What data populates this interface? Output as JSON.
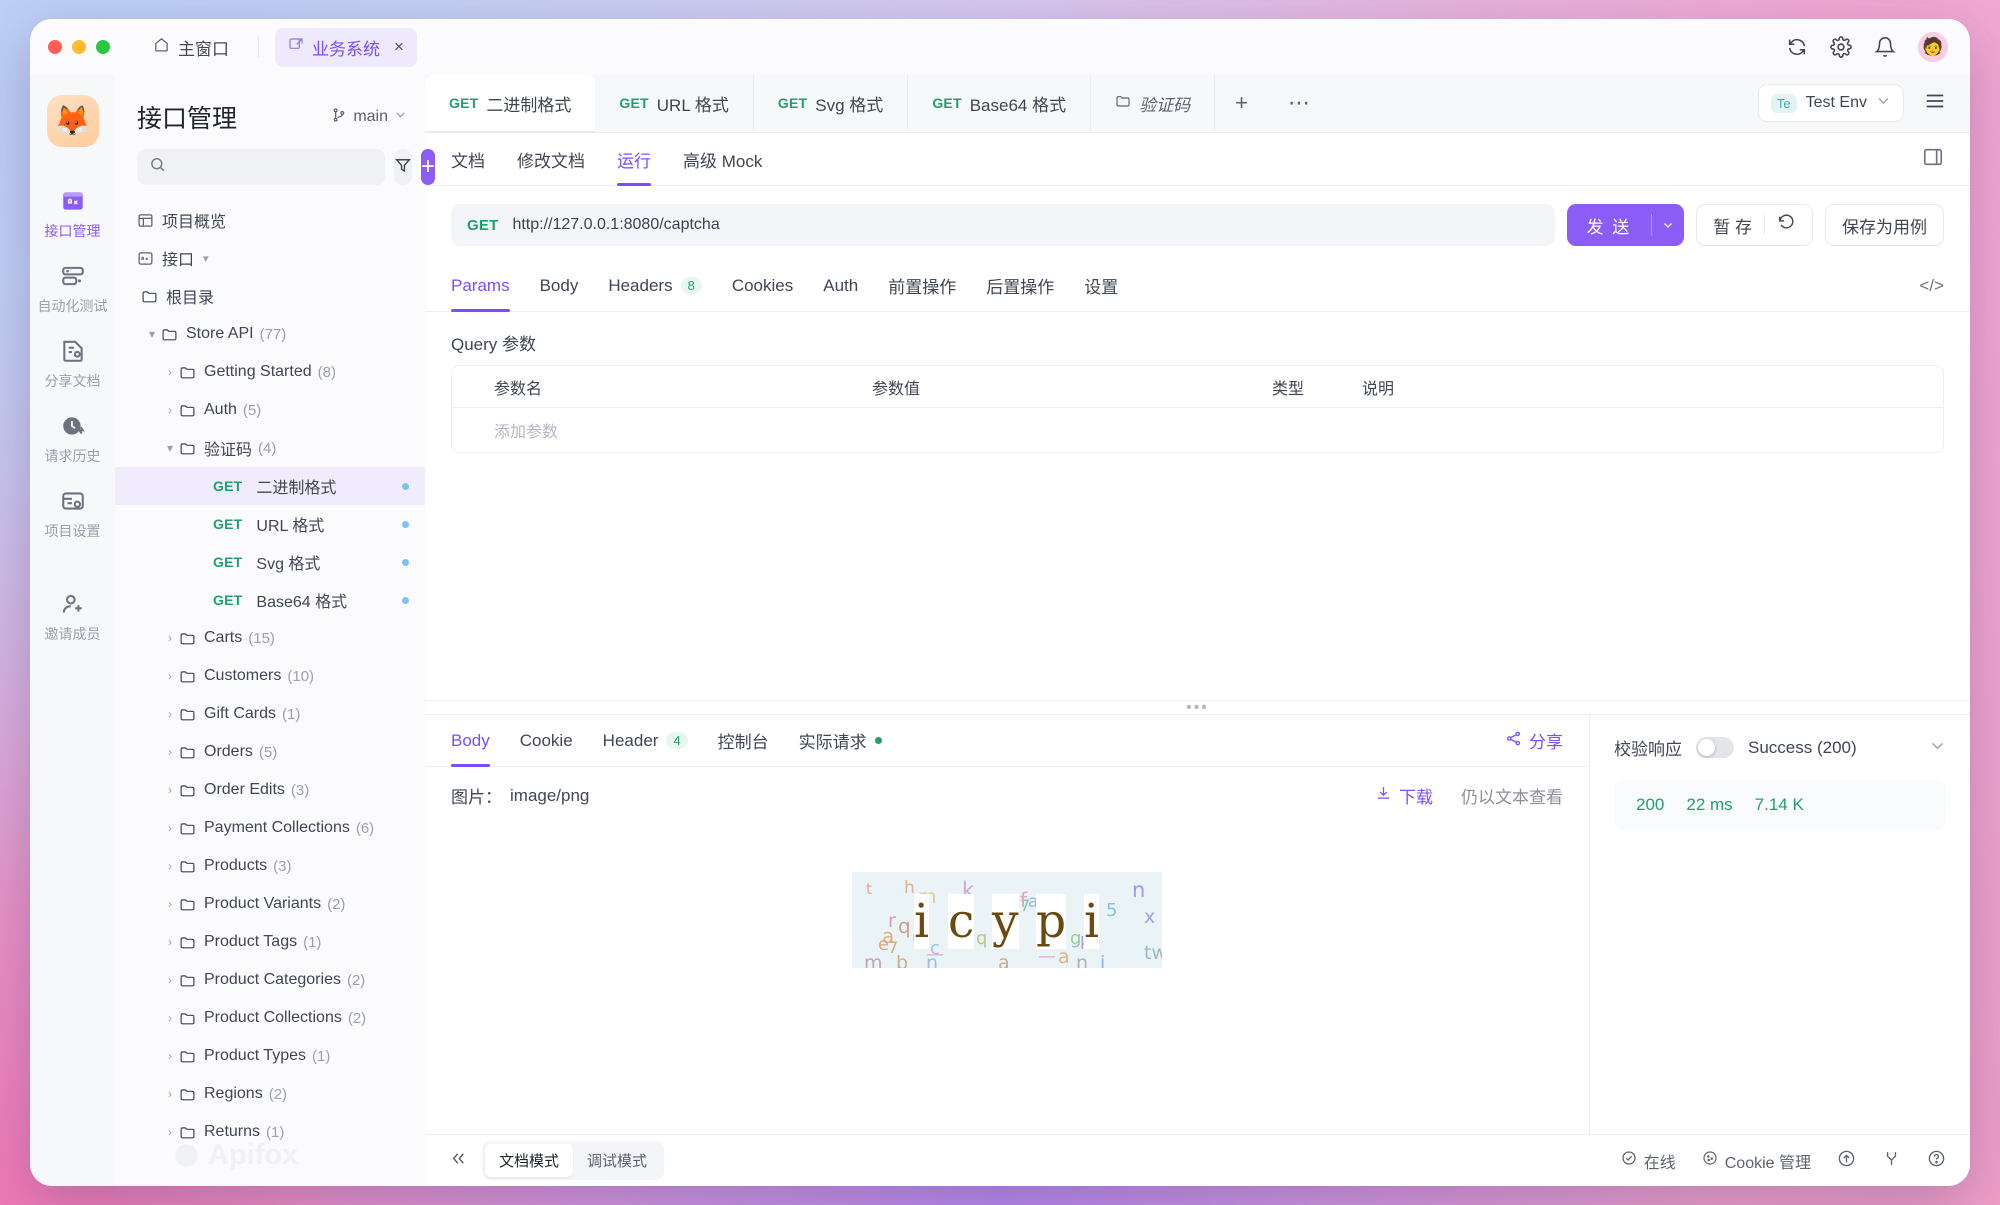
{
  "window": {
    "home_tab": "主窗口",
    "active_tab": "业务系统",
    "icons": {
      "home": "home-icon",
      "external": "external-link-icon",
      "close": "close-icon",
      "refresh": "refresh-icon",
      "settings": "gear-icon",
      "bell": "bell-icon",
      "avatar": "user-avatar"
    }
  },
  "rail": {
    "logo": "🦊",
    "items": [
      {
        "label": "接口管理",
        "icon": "api-icon",
        "active": true
      },
      {
        "label": "自动化测试",
        "icon": "automation-icon",
        "active": false
      },
      {
        "label": "分享文档",
        "icon": "share-doc-icon",
        "active": false
      },
      {
        "label": "请求历史",
        "icon": "history-icon",
        "active": false
      },
      {
        "label": "项目设置",
        "icon": "project-settings-icon",
        "active": false
      },
      {
        "label": "邀请成员",
        "icon": "invite-member-icon",
        "active": false
      }
    ]
  },
  "tree": {
    "title": "接口管理",
    "branch": "main",
    "search_placeholder": "",
    "overview_label": "项目概览",
    "interface_label": "接口",
    "root_label": "根目录",
    "watermark": "Apifox",
    "nodes": [
      {
        "label": "Store API",
        "count": "(77)",
        "depth": 1,
        "expanded": true,
        "type": "folder"
      },
      {
        "label": "Getting Started",
        "count": "(8)",
        "depth": 2,
        "expanded": false,
        "type": "folder"
      },
      {
        "label": "Auth",
        "count": "(5)",
        "depth": 2,
        "expanded": false,
        "type": "folder"
      },
      {
        "label": "验证码",
        "count": "(4)",
        "depth": 2,
        "expanded": true,
        "type": "folder"
      },
      {
        "label": "二进制格式",
        "method": "GET",
        "depth": 3,
        "type": "api",
        "selected": true
      },
      {
        "label": "URL 格式",
        "method": "GET",
        "depth": 3,
        "type": "api",
        "selected": false
      },
      {
        "label": "Svg 格式",
        "method": "GET",
        "depth": 3,
        "type": "api",
        "selected": false
      },
      {
        "label": "Base64 格式",
        "method": "GET",
        "depth": 3,
        "type": "api",
        "selected": false
      },
      {
        "label": "Carts",
        "count": "(15)",
        "depth": 2,
        "expanded": false,
        "type": "folder"
      },
      {
        "label": "Customers",
        "count": "(10)",
        "depth": 2,
        "expanded": false,
        "type": "folder"
      },
      {
        "label": "Gift Cards",
        "count": "(1)",
        "depth": 2,
        "expanded": false,
        "type": "folder"
      },
      {
        "label": "Orders",
        "count": "(5)",
        "depth": 2,
        "expanded": false,
        "type": "folder"
      },
      {
        "label": "Order Edits",
        "count": "(3)",
        "depth": 2,
        "expanded": false,
        "type": "folder"
      },
      {
        "label": "Payment Collections",
        "count": "(6)",
        "depth": 2,
        "expanded": false,
        "type": "folder"
      },
      {
        "label": "Products",
        "count": "(3)",
        "depth": 2,
        "expanded": false,
        "type": "folder"
      },
      {
        "label": "Product Variants",
        "count": "(2)",
        "depth": 2,
        "expanded": false,
        "type": "folder"
      },
      {
        "label": "Product Tags",
        "count": "(1)",
        "depth": 2,
        "expanded": false,
        "type": "folder"
      },
      {
        "label": "Product Categories",
        "count": "(2)",
        "depth": 2,
        "expanded": false,
        "type": "folder"
      },
      {
        "label": "Product Collections",
        "count": "(2)",
        "depth": 2,
        "expanded": false,
        "type": "folder"
      },
      {
        "label": "Product Types",
        "count": "(1)",
        "depth": 2,
        "expanded": false,
        "type": "folder"
      },
      {
        "label": "Regions",
        "count": "(2)",
        "depth": 2,
        "expanded": false,
        "type": "folder"
      },
      {
        "label": "Returns",
        "count": "(1)",
        "depth": 2,
        "expanded": false,
        "type": "folder"
      }
    ]
  },
  "editor_tabs": [
    {
      "method": "GET",
      "label": "二进制格式",
      "active": true,
      "type": "api"
    },
    {
      "method": "GET",
      "label": "URL 格式",
      "active": false,
      "type": "api"
    },
    {
      "method": "GET",
      "label": "Svg 格式",
      "active": false,
      "type": "api"
    },
    {
      "method": "GET",
      "label": "Base64 格式",
      "active": false,
      "type": "api"
    },
    {
      "label": "验证码",
      "active": false,
      "type": "folder"
    }
  ],
  "editor_tab_actions": {
    "add": "+",
    "more": "⋯"
  },
  "environment": {
    "badge": "Te",
    "name": "Test Env"
  },
  "subtabs": [
    {
      "label": "文档",
      "active": false
    },
    {
      "label": "修改文档",
      "active": false
    },
    {
      "label": "运行",
      "active": true
    },
    {
      "label": "高级 Mock",
      "active": false
    }
  ],
  "request": {
    "method": "GET",
    "url": "http://127.0.0.1:8080/captcha",
    "send_label": "发 送",
    "stash_label": "暂 存",
    "save_case_label": "保存为用例",
    "reset_icon": "reset-icon"
  },
  "param_tabs": [
    {
      "label": "Params",
      "active": true
    },
    {
      "label": "Body",
      "active": false
    },
    {
      "label": "Headers",
      "badge": "8",
      "active": false
    },
    {
      "label": "Cookies",
      "active": false
    },
    {
      "label": "Auth",
      "active": false
    },
    {
      "label": "前置操作",
      "active": false
    },
    {
      "label": "后置操作",
      "active": false
    },
    {
      "label": "设置",
      "active": false
    }
  ],
  "query": {
    "title": "Query 参数",
    "columns": [
      "参数名",
      "参数值",
      "类型",
      "说明"
    ],
    "add_placeholder": "添加参数"
  },
  "response": {
    "tabs": [
      {
        "label": "Body",
        "active": true
      },
      {
        "label": "Cookie",
        "active": false
      },
      {
        "label": "Header",
        "badge": "4",
        "active": false
      },
      {
        "label": "控制台",
        "active": false
      },
      {
        "label": "实际请求",
        "dot": true,
        "active": false
      }
    ],
    "share_label": "分享",
    "image_label": "图片：",
    "image_type": "image/png",
    "download_label": "下载",
    "view_as_text_label": "仍以文本查看",
    "captcha_text": "icypi",
    "validate_label": "校验响应",
    "validate_on": false,
    "result_label": "Success (200)",
    "status_code": "200",
    "time": "22 ms",
    "size": "7.14 K"
  },
  "statusbar": {
    "collapse_icon": "collapse-icon",
    "modes": [
      {
        "label": "文档模式",
        "active": true
      },
      {
        "label": "调试模式",
        "active": false
      }
    ],
    "online_label": "在线",
    "cookie_label": "Cookie 管理",
    "icons": [
      "upload-icon",
      "branch-icon",
      "help-icon"
    ]
  }
}
